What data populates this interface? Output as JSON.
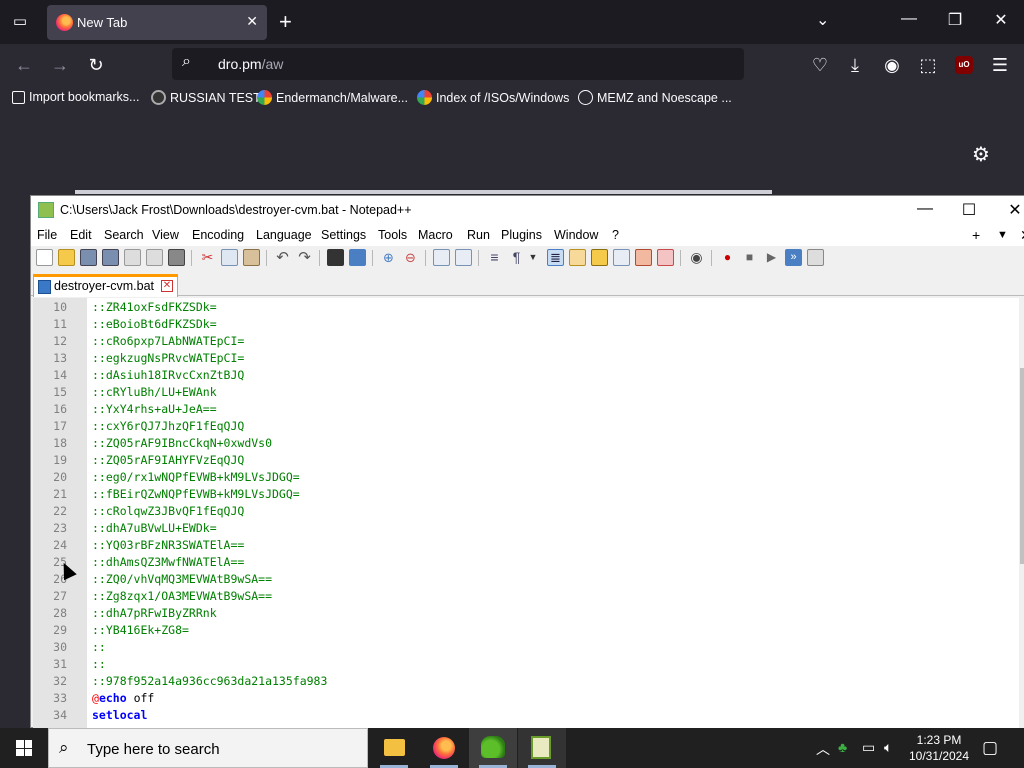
{
  "browser": {
    "tab_title": "New Tab",
    "url_host": "dro.pm",
    "url_path": "/aw",
    "bookmarks": [
      {
        "label": "Import bookmarks..."
      },
      {
        "label": "RUSSIAN TEST"
      },
      {
        "label": "Endermanch/Malware..."
      },
      {
        "label": "Index of /ISOs/Windows"
      },
      {
        "label": "MEMZ and Noescape ..."
      }
    ],
    "extension_badge": "uO"
  },
  "notepad": {
    "title": "C:\\Users\\Jack Frost\\Downloads\\destroyer-cvm.bat - Notepad++",
    "menus": [
      "File",
      "Edit",
      "Search",
      "View",
      "Encoding",
      "Language",
      "Settings",
      "Tools",
      "Macro",
      "Run",
      "Plugins",
      "Window",
      "?"
    ],
    "menu_right": [
      "+",
      "▼",
      "✕"
    ],
    "tab_label": "destroyer-cvm.bat",
    "lines": [
      {
        "n": "10",
        "text": "::ZR41oxFsdFKZSDk=",
        "style": "comment"
      },
      {
        "n": "11",
        "text": "::eBoioBt6dFKZSDk=",
        "style": "comment"
      },
      {
        "n": "12",
        "text": "::cRo6pxp7LAbNWATEpCI=",
        "style": "comment"
      },
      {
        "n": "13",
        "text": "::egkzugNsPRvcWATEpCI=",
        "style": "comment"
      },
      {
        "n": "14",
        "text": "::dAsiuh18IRvcCxnZtBJQ",
        "style": "comment"
      },
      {
        "n": "15",
        "text": "::cRYluBh/LU+EWAnk",
        "style": "comment"
      },
      {
        "n": "16",
        "text": "::YxY4rhs+aU+JeA==",
        "style": "comment"
      },
      {
        "n": "17",
        "text": "::cxY6rQJ7JhzQF1fEqQJQ",
        "style": "comment"
      },
      {
        "n": "18",
        "text": "::ZQ05rAF9IBncCkqN+0xwdVs0",
        "style": "comment"
      },
      {
        "n": "19",
        "text": "::ZQ05rAF9IAHYFVzEqQJQ",
        "style": "comment"
      },
      {
        "n": "20",
        "text": "::eg0/rx1wNQPfEVWB+kM9LVsJDGQ=",
        "style": "comment"
      },
      {
        "n": "21",
        "text": "::fBEirQZwNQPfEVWB+kM9LVsJDGQ=",
        "style": "comment"
      },
      {
        "n": "22",
        "text": "::cRolqwZ3JBvQF1fEqQJQ",
        "style": "comment"
      },
      {
        "n": "23",
        "text": "::dhA7uBVwLU+EWDk=",
        "style": "comment"
      },
      {
        "n": "24",
        "text": "::YQ03rBFzNR3SWATElA==",
        "style": "comment"
      },
      {
        "n": "25",
        "text": "::dhAmsQZ3MwfNWATElA==",
        "style": "comment"
      },
      {
        "n": "26",
        "text": "::ZQ0/vhVqMQ3MEVWAtB9wSA==",
        "style": "comment"
      },
      {
        "n": "27",
        "text": "::Zg8zqx1/OA3MEVWAtB9wSA==",
        "style": "comment"
      },
      {
        "n": "28",
        "text": "::dhA7pRFwIByZRRnk",
        "style": "comment"
      },
      {
        "n": "29",
        "text": "::YB416Ek+ZG8=",
        "style": "comment"
      },
      {
        "n": "30",
        "text": "::",
        "style": "comment"
      },
      {
        "n": "31",
        "text": "::",
        "style": "comment"
      },
      {
        "n": "32",
        "text": "::978f952a14a936cc963da21a135fa983",
        "style": "comment"
      },
      {
        "n": "33",
        "text_at": "@",
        "text_kw": "echo",
        "text_rest": " off",
        "style": "echo"
      },
      {
        "n": "34",
        "text": "setlocal",
        "style": "keyword"
      }
    ]
  },
  "taskbar": {
    "search_placeholder": "Type here to search",
    "time": "1:23 PM",
    "date": "10/31/2024"
  }
}
